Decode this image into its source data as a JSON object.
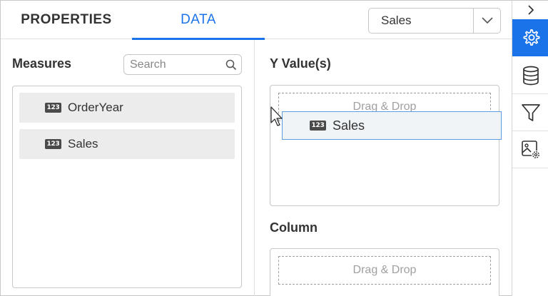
{
  "tabs": {
    "properties": "PROPERTIES",
    "data": "DATA"
  },
  "dropdown": {
    "selected": "Sales"
  },
  "measures": {
    "title": "Measures",
    "search_placeholder": "Search",
    "items": [
      {
        "badge": "123",
        "label": "OrderYear"
      },
      {
        "badge": "123",
        "label": "Sales"
      }
    ]
  },
  "y_values": {
    "title": "Y Value(s)",
    "drop_text": "Drag & Drop"
  },
  "column": {
    "title": "Column",
    "drop_text": "Drag & Drop"
  },
  "drag_ghost": {
    "badge": "123",
    "label": "Sales"
  },
  "toolbar": {
    "icons": [
      "chevron-right-icon",
      "gear-icon",
      "database-icon",
      "filter-icon",
      "image-settings-icon"
    ],
    "accent": "#1a73e8"
  }
}
